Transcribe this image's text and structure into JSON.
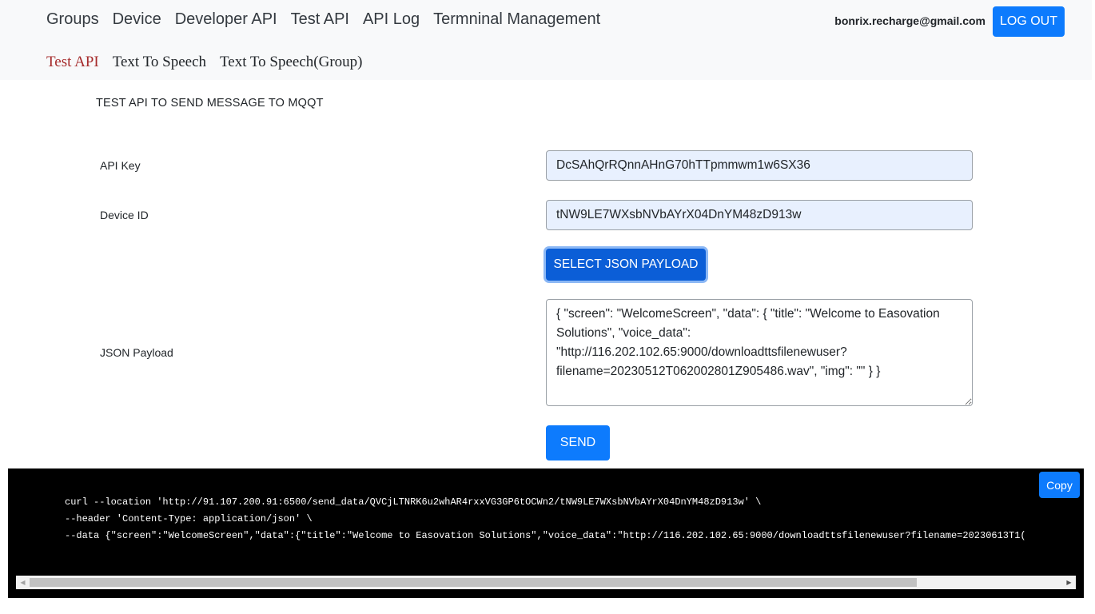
{
  "header": {
    "nav": [
      "Groups",
      "Device",
      "Developer API",
      "Test API",
      "API Log",
      "Termninal Management"
    ],
    "user_email": "bonrix.recharge@gmail.com",
    "logout_label": "LOG OUT"
  },
  "subnav": {
    "items": [
      "Test API",
      "Text To Speech",
      "Text To Speech(Group)"
    ],
    "active": "Test API"
  },
  "page": {
    "title": "TEST API TO SEND MESSAGE TO MQQT"
  },
  "form": {
    "api_key_label": "API Key",
    "api_key_value": "DcSAhQrRQnnAHnG70hTTpmmwm1w6SX36",
    "device_id_label": "Device ID",
    "device_id_value": "tNW9LE7WXsbNVbAYrX04DnYM48zD913w",
    "select_json_label": "SELECT JSON PAYLOAD",
    "json_payload_label": "JSON Payload",
    "json_payload_value": "{ \"screen\": \"WelcomeScreen\", \"data\": { \"title\": \"Welcome to Easovation Solutions\", \"voice_data\": \"http://116.202.102.65:9000/downloadttsfilenewuser?filename=20230512T062002801Z905486.wav\", \"img\": \"\" } }",
    "send_label": "SEND"
  },
  "code": {
    "copy_label": "Copy",
    "lines": [
      "curl --location 'http://91.107.200.91:6500/send_data/QVCjLTNRK6u2whAR4rxxVG3GP6tOCWn2/tNW9LE7WXsbNVbAYrX04DnYM48zD913w' \\",
      "--header 'Content-Type: application/json' \\",
      "--data {\"screen\":\"WelcomeScreen\",\"data\":{\"title\":\"Welcome to Easovation Solutions\",\"voice_data\":\"http://116.202.102.65:9000/downloadttsfilenewuser?filename=20230613T1("
    ]
  },
  "icons": {
    "scroll_left": "scroll-left-arrow-icon",
    "scroll_right": "scroll-right-arrow-icon"
  }
}
